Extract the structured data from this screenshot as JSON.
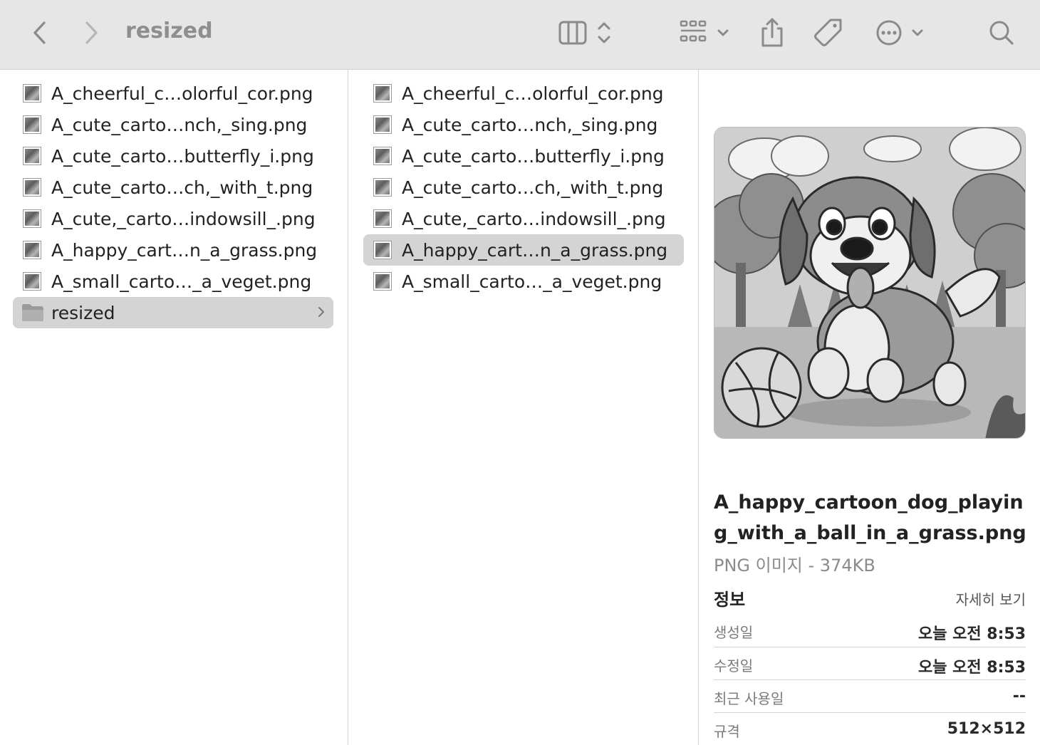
{
  "window": {
    "title": "resized"
  },
  "toolbar": {
    "back": "back-icon",
    "forward": "forward-icon",
    "view": "columns-view-icon",
    "group": "grid-group-icon",
    "share": "share-icon",
    "tag": "tag-icon",
    "more": "ellipsis-icon",
    "search": "search-icon"
  },
  "column1": {
    "items": [
      {
        "name": "A_cheerful_c…olorful_cor.png"
      },
      {
        "name": "A_cute_carto…nch,_sing.png"
      },
      {
        "name": "A_cute_carto…butterfly_i.png"
      },
      {
        "name": "A_cute_carto…ch,_with_t.png"
      },
      {
        "name": "A_cute,_carto…indowsill_.png"
      },
      {
        "name": "A_happy_cart…n_a_grass.png"
      },
      {
        "name": "A_small_carto…_a_veget.png"
      }
    ],
    "folder": {
      "name": "resized"
    }
  },
  "column2": {
    "items": [
      {
        "name": "A_cheerful_c…olorful_cor.png"
      },
      {
        "name": "A_cute_carto…nch,_sing.png"
      },
      {
        "name": "A_cute_carto…butterfly_i.png"
      },
      {
        "name": "A_cute_carto…ch,_with_t.png"
      },
      {
        "name": "A_cute,_carto…indowsill_.png"
      },
      {
        "name": "A_happy_cart…n_a_grass.png"
      },
      {
        "name": "A_small_carto…_a_veget.png"
      }
    ],
    "selected_index": 5
  },
  "preview": {
    "filename": "A_happy_cartoon_dog_playing_with_a_ball_in_a_grass.png",
    "kind": "PNG 이미지 - 374KB",
    "info_heading": "정보",
    "more_info": "자세히 보기",
    "info": [
      {
        "label": "생성일",
        "value": "오늘 오전 8:53"
      },
      {
        "label": "수정일",
        "value": "오늘 오전 8:53"
      },
      {
        "label": "최근 사용일",
        "value": "--"
      },
      {
        "label": "규격",
        "value": "512×512"
      }
    ]
  }
}
